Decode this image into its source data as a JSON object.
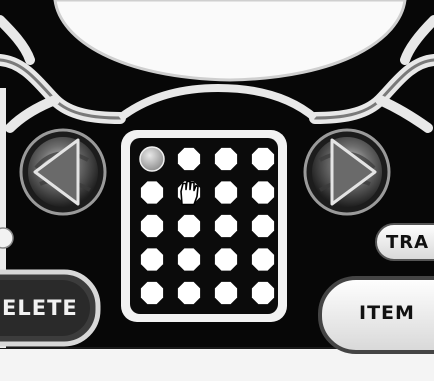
{
  "screen": "memory-slot-selector",
  "buttons": {
    "delete_label": "ELETE",
    "item_label": "ITEM",
    "tra_label": "TRA"
  },
  "grid": {
    "columns": 4,
    "rows": 5,
    "selected_index": 0,
    "cursor_index": 5
  },
  "arrows": {
    "left": "left-arrow-icon",
    "right": "right-arrow-icon"
  },
  "colors": {
    "panel": "#0b0b0b",
    "slot": "#ffffff",
    "selected_slot": "#bdbdbd",
    "frame": "#f2f2f2",
    "background": "#f4f4f4"
  }
}
